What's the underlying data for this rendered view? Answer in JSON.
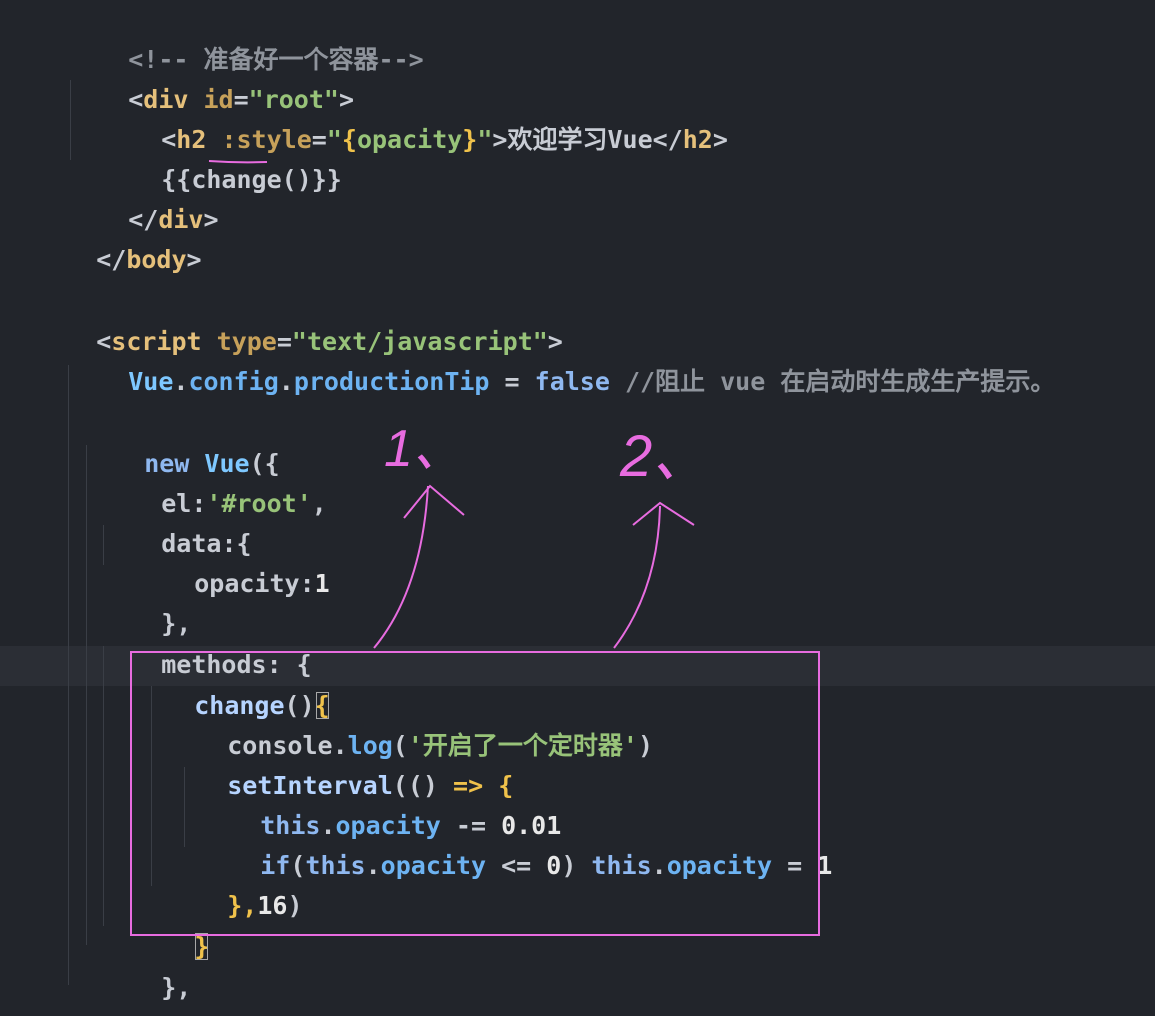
{
  "code": {
    "l1": [
      "<!-- ",
      "准备好一个容器",
      "-->"
    ],
    "l2": [
      "<",
      "div",
      " id",
      "=",
      "\"root\"",
      ">"
    ],
    "l3": [
      "<",
      "h2",
      " :style",
      "=",
      "\"",
      "{",
      "opacity",
      "}",
      "\"",
      ">",
      "欢迎学习Vue",
      "</",
      "h2",
      ">"
    ],
    "l4": [
      "{{",
      "change",
      "()",
      "}}"
    ],
    "l5": [
      "</",
      "div",
      ">"
    ],
    "l6": [
      "</",
      "body",
      ">"
    ],
    "l7": [
      "<",
      "script",
      " type",
      "=",
      "\"text/javascript\"",
      ">"
    ],
    "l8": [
      "Vue",
      ".",
      "config",
      ".",
      "productionTip",
      " = ",
      "false",
      " //阻止 vue 在启动时生成生产提示。"
    ],
    "l9": [
      "new",
      " Vue",
      "({"
    ],
    "l10": [
      "el",
      ":",
      "'#root'",
      ","
    ],
    "l11": [
      "data",
      ":{"
    ],
    "l12": [
      "opacity",
      ":",
      "1"
    ],
    "l13": [
      "},"
    ],
    "l14": [
      "methods",
      ": {"
    ],
    "l15": [
      "change",
      "()",
      "{"
    ],
    "l16": [
      "console",
      ".",
      "log",
      "(",
      "'开启了一个定时器'",
      ")"
    ],
    "l17": [
      "setInterval",
      "((",
      ")",
      " => ",
      "{"
    ],
    "l18": [
      "this",
      ".",
      "opacity",
      " -= ",
      "0.01"
    ],
    "l19": [
      "if",
      "(",
      "this",
      ".",
      "opacity",
      " <= ",
      "0",
      ") ",
      "this",
      ".",
      "opacity",
      " = ",
      "1"
    ],
    "l20": [
      "},",
      "16",
      ")"
    ],
    "l21": [
      "}"
    ],
    "l22": [
      "},"
    ],
    "l23": [
      "})"
    ]
  },
  "annotations": {
    "label1": "1、",
    "label2": "2、",
    "color": "#e86ce0"
  }
}
